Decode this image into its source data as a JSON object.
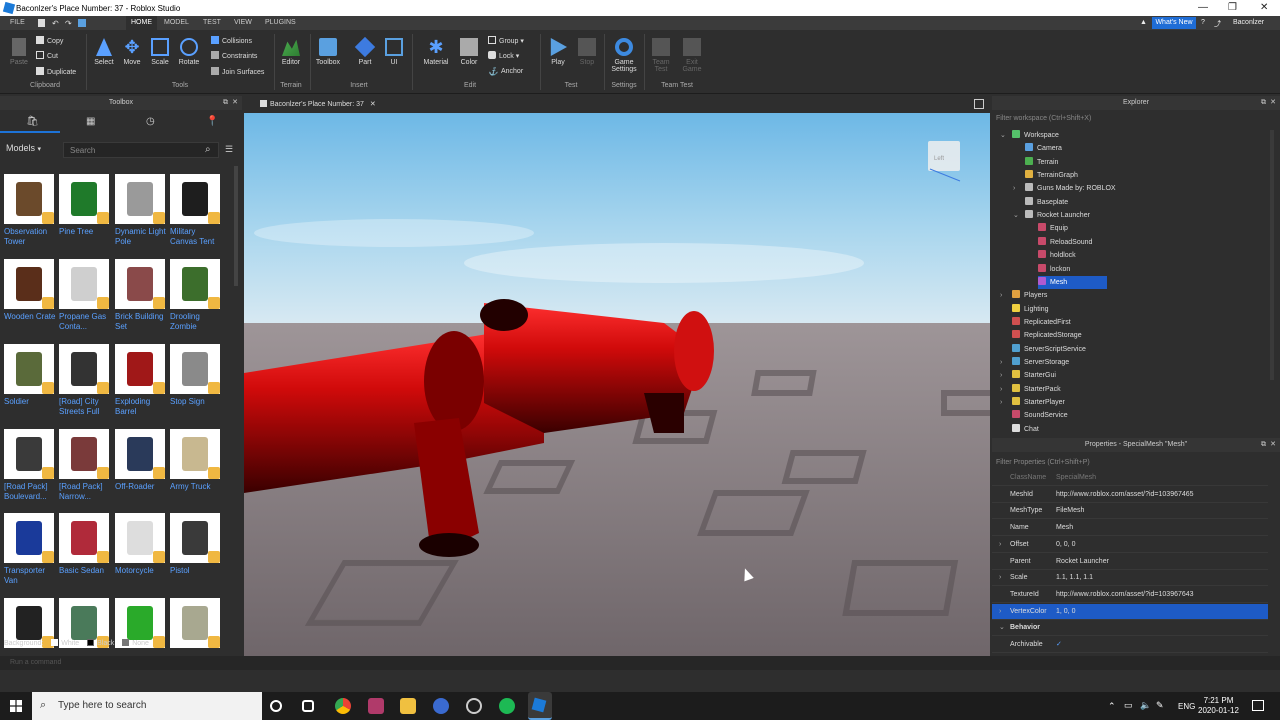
{
  "window": {
    "title": "Baconlzer's Place Number: 37 - Roblox Studio"
  },
  "menu": {
    "tabs": [
      "FILE",
      "HOME",
      "MODEL",
      "TEST",
      "VIEW",
      "PLUGINS"
    ],
    "active": "HOME",
    "whats_new": "What's New",
    "user": "Baconlzer"
  },
  "ribbon": {
    "clipboard": {
      "paste": "Paste",
      "copy": "Copy",
      "cut": "Cut",
      "duplicate": "Duplicate",
      "group": "Clipboard"
    },
    "tools": {
      "select": "Select",
      "move": "Move",
      "scale": "Scale",
      "rotate": "Rotate",
      "collisions": "Collisions",
      "constraints": "Constraints",
      "join_surfaces": "Join Surfaces",
      "group": "Tools"
    },
    "terrain": {
      "editor": "Editor",
      "group": "Terrain"
    },
    "insert": {
      "toolbox": "Toolbox",
      "part": "Part",
      "ui": "UI",
      "group": "Insert"
    },
    "edit": {
      "material": "Material",
      "color": "Color",
      "group_btn": "Group",
      "lock": "Lock",
      "anchor": "Anchor",
      "group": "Edit"
    },
    "test": {
      "play": "Play",
      "stop": "Stop",
      "group": "Test"
    },
    "settings": {
      "game_settings_1": "Game",
      "game_settings_2": "Settings",
      "group": "Settings"
    },
    "team_test": {
      "team_1": "Team",
      "team_2": "Test",
      "exit_1": "Exit",
      "exit_2": "Game",
      "group": "Team Test"
    }
  },
  "toolbox": {
    "title": "Toolbox",
    "category": "Models",
    "search_placeholder": "Search",
    "items": [
      {
        "label": "Observation Tower",
        "color": "#6b4a2b"
      },
      {
        "label": "Pine Tree",
        "color": "#1f7a2a"
      },
      {
        "label": "Dynamic Light Pole",
        "color": "#9a9a9a"
      },
      {
        "label": "Military Canvas Tent",
        "color": "#1e1e1e"
      },
      {
        "label": "Wooden Crate",
        "color": "#5a2e1a"
      },
      {
        "label": "Propane Gas Conta...",
        "color": "#cfcfcf"
      },
      {
        "label": "Brick Building Set",
        "color": "#8a4a4a"
      },
      {
        "label": "Drooling Zombie",
        "color": "#3c6e2c"
      },
      {
        "label": "Soldier",
        "color": "#5a6a3a"
      },
      {
        "label": "[Road] City Streets Full",
        "color": "#333333"
      },
      {
        "label": "Exploding Barrel",
        "color": "#a01818"
      },
      {
        "label": "Stop Sign",
        "color": "#8a8a8a"
      },
      {
        "label": "[Road Pack] Boulevard...",
        "color": "#3a3a3a"
      },
      {
        "label": "[Road Pack] Narrow...",
        "color": "#7a3a3a"
      },
      {
        "label": "Off-Roader",
        "color": "#2a3a5a"
      },
      {
        "label": "Army Truck",
        "color": "#c8b890"
      },
      {
        "label": "Transporter Van",
        "color": "#1a3a9a"
      },
      {
        "label": "Basic Sedan",
        "color": "#b02a3a"
      },
      {
        "label": "Motorcycle",
        "color": "#dddddd"
      },
      {
        "label": "Pistol",
        "color": "#3a3a3a"
      },
      {
        "label": "",
        "color": "#222222"
      },
      {
        "label": "",
        "color": "#4a7a5a"
      },
      {
        "label": "",
        "color": "#2aaa2a"
      },
      {
        "label": "",
        "color": "#a8a890"
      }
    ],
    "background_label": "Background:",
    "bg_white": "White",
    "bg_black": "Black",
    "bg_none": "None"
  },
  "viewport": {
    "tab": "Baconlzer's Place Number: 37",
    "gizmo_label": "Left"
  },
  "explorer": {
    "title": "Explorer",
    "filter_placeholder": "Filter workspace (Ctrl+Shift+X)",
    "tree": [
      {
        "label": "Workspace",
        "depth": 0,
        "expand": "v",
        "color": "#55c26b"
      },
      {
        "label": "Camera",
        "depth": 1,
        "expand": "",
        "color": "#5aa0e0"
      },
      {
        "label": "Terrain",
        "depth": 1,
        "expand": "",
        "color": "#4caf50"
      },
      {
        "label": "TerrainGraph",
        "depth": 1,
        "expand": "",
        "color": "#e0b040"
      },
      {
        "label": "Guns Made by: ROBLOX",
        "depth": 1,
        "expand": ">",
        "color": "#bbbbbb"
      },
      {
        "label": "Baseplate",
        "depth": 1,
        "expand": "",
        "color": "#bbbbbb"
      },
      {
        "label": "Rocket Launcher",
        "depth": 1,
        "expand": "v",
        "color": "#bbbbbb"
      },
      {
        "label": "Equip",
        "depth": 2,
        "expand": "",
        "color": "#c84a6a"
      },
      {
        "label": "ReloadSound",
        "depth": 2,
        "expand": "",
        "color": "#c84a6a"
      },
      {
        "label": "holdlock",
        "depth": 2,
        "expand": "",
        "color": "#c84a6a"
      },
      {
        "label": "lockon",
        "depth": 2,
        "expand": "",
        "color": "#c84a6a"
      },
      {
        "label": "Mesh",
        "depth": 2,
        "expand": "",
        "color": "#b05ad0",
        "selected": true
      },
      {
        "label": "Players",
        "depth": 0,
        "expand": ">",
        "color": "#e0a040"
      },
      {
        "label": "Lighting",
        "depth": 0,
        "expand": "",
        "color": "#f0d040"
      },
      {
        "label": "ReplicatedFirst",
        "depth": 0,
        "expand": "",
        "color": "#d05050"
      },
      {
        "label": "ReplicatedStorage",
        "depth": 0,
        "expand": "",
        "color": "#d05050"
      },
      {
        "label": "ServerScriptService",
        "depth": 0,
        "expand": "",
        "color": "#50a0d0"
      },
      {
        "label": "ServerStorage",
        "depth": 0,
        "expand": ">",
        "color": "#50a0d0"
      },
      {
        "label": "StarterGui",
        "depth": 0,
        "expand": ">",
        "color": "#e0c040"
      },
      {
        "label": "StarterPack",
        "depth": 0,
        "expand": ">",
        "color": "#e0c040"
      },
      {
        "label": "StarterPlayer",
        "depth": 0,
        "expand": ">",
        "color": "#e0c040"
      },
      {
        "label": "SoundService",
        "depth": 0,
        "expand": "",
        "color": "#c84a6a"
      },
      {
        "label": "Chat",
        "depth": 0,
        "expand": "",
        "color": "#dddddd"
      }
    ]
  },
  "properties": {
    "title": "Properties - SpecialMesh \"Mesh\"",
    "filter_placeholder": "Filter Properties (Ctrl+Shift+P)",
    "rows": [
      {
        "key": "ClassName",
        "value": "SpecialMesh",
        "arrow": "",
        "dim": true
      },
      {
        "key": "MeshId",
        "value": "http://www.roblox.com/asset/?id=103967465",
        "arrow": ""
      },
      {
        "key": "MeshType",
        "value": "FileMesh",
        "arrow": ""
      },
      {
        "key": "Name",
        "value": "Mesh",
        "arrow": ""
      },
      {
        "key": "Offset",
        "value": "0, 0, 0",
        "arrow": ">"
      },
      {
        "key": "Parent",
        "value": "Rocket Launcher",
        "arrow": ""
      },
      {
        "key": "Scale",
        "value": "1.1, 1.1, 1.1",
        "arrow": ">"
      },
      {
        "key": "TextureId",
        "value": "http://www.roblox.com/asset/?id=103967643",
        "arrow": ""
      },
      {
        "key": "VertexColor",
        "value": "1, 0, 0",
        "arrow": ">",
        "selected": true
      },
      {
        "key": "Behavior",
        "value": "",
        "arrow": "v",
        "section": true
      },
      {
        "key": "Archivable",
        "value": "✓",
        "arrow": ""
      }
    ]
  },
  "command_bar": {
    "placeholder": "Run a command"
  },
  "taskbar": {
    "search_placeholder": "Type here to search",
    "lang": "ENG",
    "time": "7:21 PM",
    "date": "2020-01-12"
  }
}
